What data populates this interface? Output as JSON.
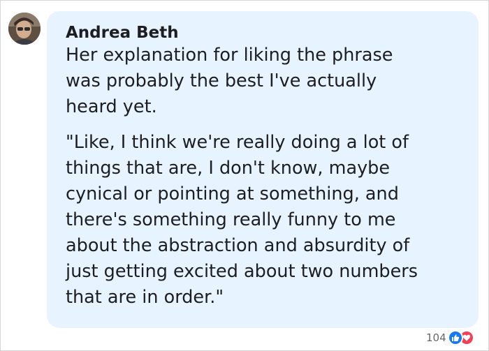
{
  "comment": {
    "author": "Andrea Beth",
    "paragraphs": [
      "Her explanation for liking the phrase\nwas probably the best I've actually\nheard yet.",
      "\"Like, I think we're really doing a lot of\nthings that are, I don't know, maybe\ncynical or pointing at something, and\nthere's something really funny to me\nabout the abstraction and absurdity of\njust getting excited about two numbers\nthat are in order.\""
    ],
    "reactions": {
      "count": "104",
      "icons": [
        "like-icon",
        "love-icon"
      ],
      "colors": {
        "like": "#1877f2",
        "love": "#f33e58"
      }
    },
    "bubble_color": "#e7f3ff"
  }
}
